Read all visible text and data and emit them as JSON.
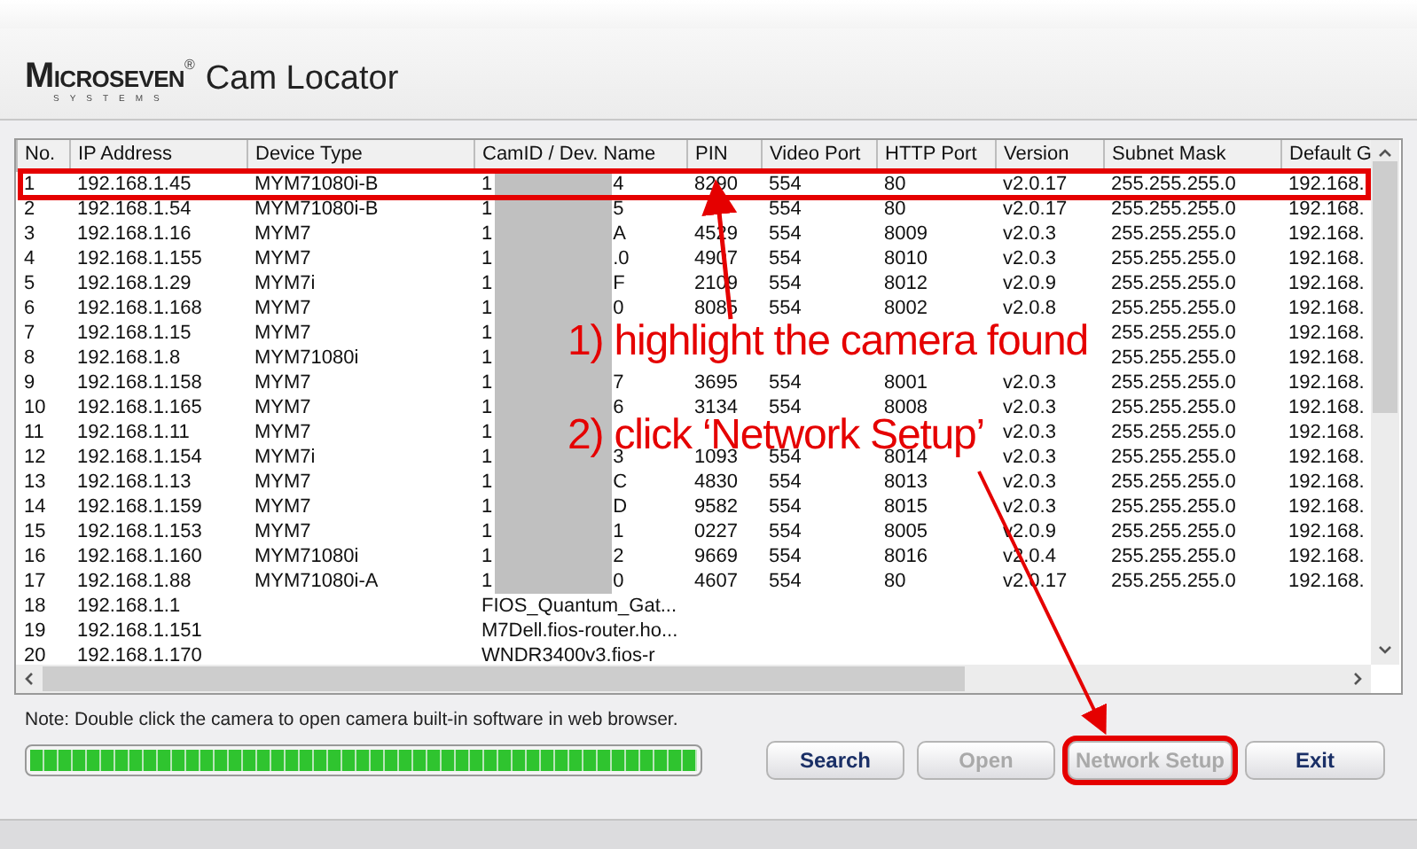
{
  "header": {
    "logo": "MICROSEVEN",
    "logo_mark": "®",
    "logo_sub": "SYSTEMS",
    "title": "Cam Locator"
  },
  "table": {
    "columns": [
      "No.",
      "IP Address",
      "Device Type",
      "CamID / Dev. Name",
      "PIN",
      "Video Port",
      "HTTP Port",
      "Version",
      "Subnet Mask",
      "Default G"
    ],
    "rows": [
      {
        "no": "1",
        "ip": "192.168.1.45",
        "type": "MYM71080i-B",
        "cam_start": "1",
        "cam_end": "4",
        "redacted": true,
        "pin": "8290",
        "video": "554",
        "http": "80",
        "version": "v2.0.17",
        "mask": "255.255.255.0",
        "gateway": "192.168.",
        "outlined": true
      },
      {
        "no": "2",
        "ip": "192.168.1.54",
        "type": "MYM71080i-B",
        "cam_start": "1",
        "cam_end": "5",
        "redacted": true,
        "video": "554",
        "http": "80",
        "version": "v2.0.17",
        "mask": "255.255.255.0",
        "gateway": "192.168.",
        "outlined": false
      },
      {
        "no": "3",
        "ip": "192.168.1.16",
        "type": "MYM7",
        "cam_start": "1",
        "cam_end": "A",
        "redacted": true,
        "pin": "4529",
        "video": "554",
        "http": "8009",
        "version": "v2.0.3",
        "mask": "255.255.255.0",
        "gateway": "192.168.",
        "outlined": false
      },
      {
        "no": "4",
        "ip": "192.168.1.155",
        "type": "MYM7",
        "cam_start": "1",
        "cam_end": ".0",
        "redacted": true,
        "pin": "4907",
        "video": "554",
        "http": "8010",
        "version": "v2.0.3",
        "mask": "255.255.255.0",
        "gateway": "192.168.",
        "outlined": false
      },
      {
        "no": "5",
        "ip": "192.168.1.29",
        "type": "MYM7i",
        "cam_start": "1",
        "cam_end": "F",
        "redacted": true,
        "pin": "2109",
        "video": "554",
        "http": "8012",
        "version": "v2.0.9",
        "mask": "255.255.255.0",
        "gateway": "192.168.",
        "outlined": false
      },
      {
        "no": "6",
        "ip": "192.168.1.168",
        "type": "MYM7",
        "cam_start": "1",
        "cam_end": "0",
        "redacted": true,
        "pin": "8085",
        "video": "554",
        "http": "8002",
        "version": "v2.0.8",
        "mask": "255.255.255.0",
        "gateway": "192.168.",
        "outlined": false
      },
      {
        "no": "7",
        "ip": "192.168.1.15",
        "type": "MYM7",
        "cam_start": "1",
        "redacted": true,
        "mask": "255.255.255.0",
        "gateway": "192.168.",
        "outlined": false
      },
      {
        "no": "8",
        "ip": "192.168.1.8",
        "type": "MYM71080i",
        "cam_start": "1",
        "redacted": true,
        "mask": "255.255.255.0",
        "gateway": "192.168.",
        "outlined": false
      },
      {
        "no": "9",
        "ip": "192.168.1.158",
        "type": "MYM7",
        "cam_start": "1",
        "cam_end": "7",
        "redacted": true,
        "pin": "3695",
        "video": "554",
        "http": "8001",
        "version": "v2.0.3",
        "mask": "255.255.255.0",
        "gateway": "192.168.",
        "outlined": false
      },
      {
        "no": "10",
        "ip": "192.168.1.165",
        "type": "MYM7",
        "cam_start": "1",
        "cam_end": "6",
        "redacted": true,
        "pin": "3134",
        "video": "554",
        "http": "8008",
        "version": "v2.0.3",
        "mask": "255.255.255.0",
        "gateway": "192.168.",
        "outlined": false
      },
      {
        "no": "11",
        "ip": "192.168.1.11",
        "type": "MYM7",
        "cam_start": "1",
        "redacted": true,
        "version": "v2.0.3",
        "mask": "255.255.255.0",
        "gateway": "192.168.",
        "outlined": false
      },
      {
        "no": "12",
        "ip": "192.168.1.154",
        "type": "MYM7i",
        "cam_start": "1",
        "cam_end": "3",
        "redacted": true,
        "pin": "1093",
        "video": "554",
        "http": "8014",
        "version": "v2.0.3",
        "mask": "255.255.255.0",
        "gateway": "192.168.",
        "outlined": false
      },
      {
        "no": "13",
        "ip": "192.168.1.13",
        "type": "MYM7",
        "cam_start": "1",
        "cam_end": "C",
        "redacted": true,
        "pin": "4830",
        "video": "554",
        "http": "8013",
        "version": "v2.0.3",
        "mask": "255.255.255.0",
        "gateway": "192.168.",
        "outlined": false
      },
      {
        "no": "14",
        "ip": "192.168.1.159",
        "type": "MYM7",
        "cam_start": "1",
        "cam_end": "D",
        "redacted": true,
        "pin": "9582",
        "video": "554",
        "http": "8015",
        "version": "v2.0.3",
        "mask": "255.255.255.0",
        "gateway": "192.168.",
        "outlined": false
      },
      {
        "no": "15",
        "ip": "192.168.1.153",
        "type": "MYM7",
        "cam_start": "1",
        "cam_end": "1",
        "redacted": true,
        "pin": "0227",
        "video": "554",
        "http": "8005",
        "version": "v2.0.9",
        "mask": "255.255.255.0",
        "gateway": "192.168.",
        "outlined": false
      },
      {
        "no": "16",
        "ip": "192.168.1.160",
        "type": "MYM71080i",
        "cam_start": "1",
        "cam_end": "2",
        "redacted": true,
        "pin": "9669",
        "video": "554",
        "http": "8016",
        "version": "v2.0.4",
        "mask": "255.255.255.0",
        "gateway": "192.168.",
        "outlined": false
      },
      {
        "no": "17",
        "ip": "192.168.1.88",
        "type": "MYM71080i-A",
        "cam_start": "1",
        "cam_end": "0",
        "redacted": true,
        "pin": "4607",
        "video": "554",
        "http": "80",
        "version": "v2.0.17",
        "mask": "255.255.255.0",
        "gateway": "192.168.",
        "outlined": false
      },
      {
        "no": "18",
        "ip": "192.168.1.1",
        "cam_start": "FIOS_Quantum_Gat...",
        "redacted": false,
        "outlined": false
      },
      {
        "no": "19",
        "ip": "192.168.1.151",
        "cam_start": "M7Dell.fios-router.ho...",
        "redacted": false,
        "outlined": false
      },
      {
        "no": "20",
        "ip": "192.168.1.170",
        "cam_start": "WNDR3400v3.fios-r",
        "redacted": false,
        "outlined": false
      }
    ]
  },
  "note": "Note: Double click the camera to open camera built-in software in web browser.",
  "progress": {
    "level": 1
  },
  "buttons": [
    {
      "label": "Search",
      "disabled": false,
      "outlined": false
    },
    {
      "label": "Open",
      "disabled": true,
      "outlined": false
    },
    {
      "label": "Network Setup",
      "disabled": true,
      "outlined": true
    },
    {
      "label": "Exit",
      "disabled": false,
      "outlined": false
    }
  ],
  "annotations": [
    "1) highlight the camera found",
    "2) click ‘Network Setup’"
  ]
}
